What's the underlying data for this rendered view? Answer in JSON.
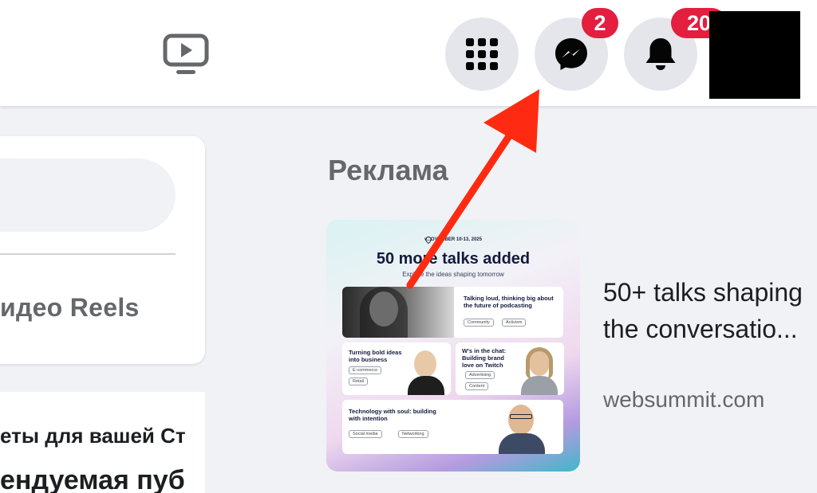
{
  "topbar": {
    "video_icon": "video-play-icon",
    "menu_icon": "grid-menu-icon",
    "messenger_icon": "messenger-icon",
    "messenger_badge": "2",
    "notifications_icon": "bell-icon",
    "notifications_badge": "20"
  },
  "left_column": {
    "reels_label": "идео Reels",
    "text_line_1": "еты для вашей Ст",
    "text_line_2": "ендуемая пуб"
  },
  "ads": {
    "heading": "Реклама",
    "image": {
      "date": "v...OVEMBER 10-13, 2025",
      "title": "50 more talks added",
      "subtitle": "Explore the ideas shaping tomorrow",
      "tiles": [
        {
          "title": "Talking loud, thinking big about the future of podcasting",
          "tags": [
            "Community",
            "Activism"
          ]
        },
        {
          "title": "Turning bold ideas into business",
          "tags": [
            "E-commerce",
            "Retail"
          ]
        },
        {
          "title": "W's in the chat: Building brand love on Twitch",
          "tags": [
            "Advertising",
            "Content"
          ]
        },
        {
          "title": "Technology with soul: building with intention",
          "tags": [
            "Social media",
            "Networking"
          ]
        }
      ]
    },
    "headline": "50+ talks shaping the conversatio...",
    "domain": "websummit.com"
  },
  "colors": {
    "badge_red": "#e41e3f",
    "arrow_red": "#fe2b12",
    "button_gray": "#e4e6eb",
    "background": "#f0f2f5"
  }
}
